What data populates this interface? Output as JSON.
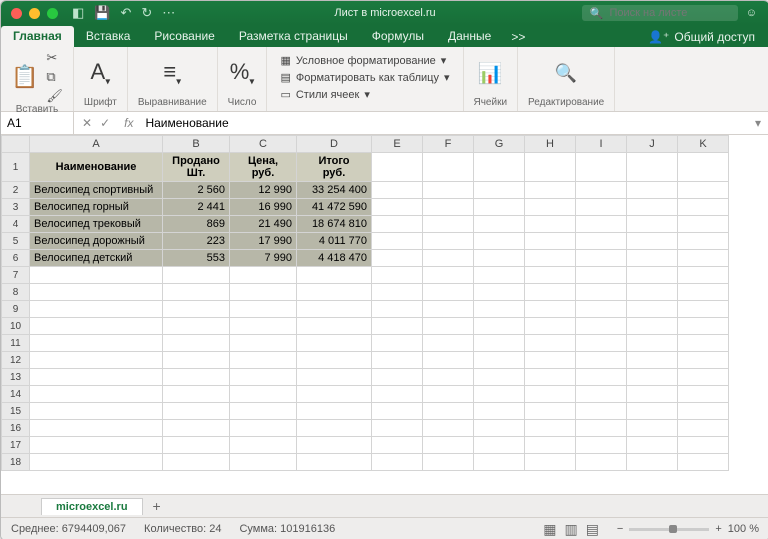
{
  "titlebar": {
    "title": "Лист в microexcel.ru",
    "search_placeholder": "Поиск на листе"
  },
  "tabs": {
    "items": [
      "Главная",
      "Вставка",
      "Рисование",
      "Разметка страницы",
      "Формулы",
      "Данные"
    ],
    "active": 0,
    "more": ">>",
    "share": "Общий доступ"
  },
  "ribbon": {
    "paste": "Вставить",
    "font": "Шрифт",
    "align": "Выравнивание",
    "number": "Число",
    "cond_format": "Условное форматирование",
    "format_table": "Форматировать как таблицу",
    "cell_styles": "Стили ячеек",
    "cells": "Ячейки",
    "editing": "Редактирование"
  },
  "formula": {
    "name": "A1",
    "fx": "fx",
    "value": "Наименование"
  },
  "columns": [
    "A",
    "B",
    "C",
    "D",
    "E",
    "F",
    "G",
    "H",
    "I",
    "J",
    "K"
  ],
  "row_count": 18,
  "headers": [
    "Наименование",
    "Продано Шт.",
    "Цена, руб.",
    "Итого руб."
  ],
  "rows": [
    [
      "Велосипед спортивный",
      "2 560",
      "12 990",
      "33 254 400"
    ],
    [
      "Велосипед горный",
      "2 441",
      "16 990",
      "41 472 590"
    ],
    [
      "Велосипед трековый",
      "869",
      "21 490",
      "18 674 810"
    ],
    [
      "Велосипед дорожный",
      "223",
      "17 990",
      "4 011 770"
    ],
    [
      "Велосипед детский",
      "553",
      "7 990",
      "4 418 470"
    ]
  ],
  "sheet": {
    "name": "microexcel.ru"
  },
  "status": {
    "avg_label": "Среднее:",
    "avg": "6794409,067",
    "count_label": "Количество:",
    "count": "24",
    "sum_label": "Сумма:",
    "sum": "101916136",
    "zoom": "100 %"
  }
}
